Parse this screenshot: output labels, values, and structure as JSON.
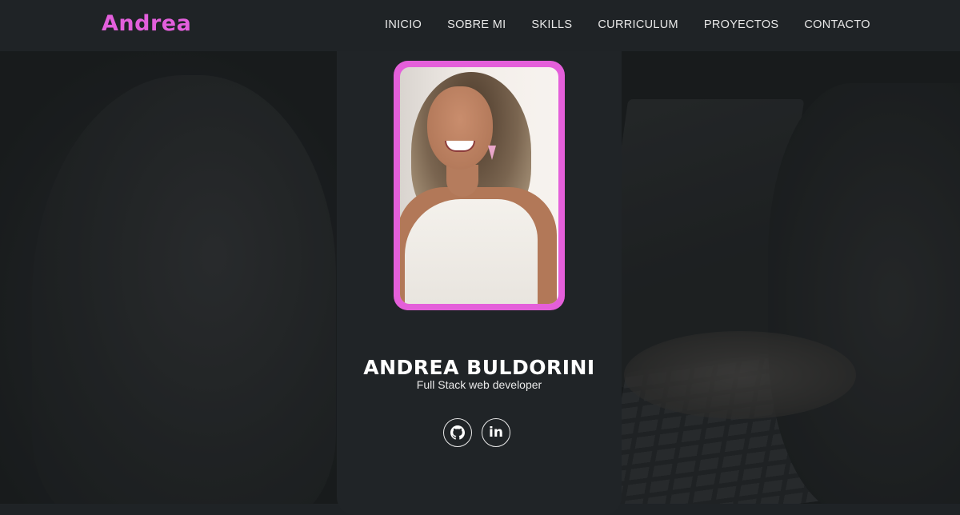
{
  "header": {
    "logo": "Andrea",
    "nav": [
      "INICIO",
      "SOBRE MI",
      "SKILLS",
      "CURRICULUM",
      "PROYECTOS",
      "CONTACTO"
    ]
  },
  "profile": {
    "name": "ANDREA BULDORINI",
    "role": "Full Stack web developer",
    "socials": [
      {
        "icon": "github-icon"
      },
      {
        "icon": "linkedin-icon",
        "glyph": "in"
      }
    ]
  },
  "colors": {
    "accent": "#e35fdc",
    "background": "#1f2326",
    "text": "#ffffff"
  }
}
